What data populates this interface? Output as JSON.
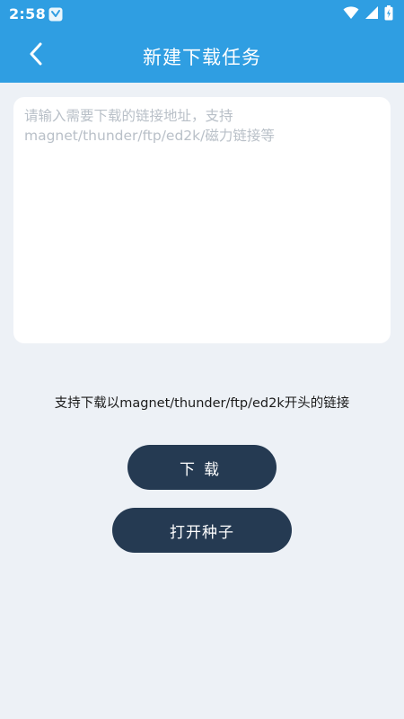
{
  "status_bar": {
    "time": "2:58",
    "background": "#2f9ee2"
  },
  "header": {
    "title": "新建下载任务",
    "back_icon": "chevron-left-icon"
  },
  "url_input": {
    "value": "",
    "placeholder": "请输入需要下载的链接地址，支持magnet/thunder/ftp/ed2k/磁力链接等"
  },
  "hint": "支持下载以magnet/thunder/ftp/ed2k开头的链接",
  "buttons": {
    "download_label": "下载",
    "open_torrent_label": "打开种子"
  },
  "colors": {
    "accent": "#2f9ee2",
    "button": "#253a52",
    "background": "#edf1f6"
  }
}
